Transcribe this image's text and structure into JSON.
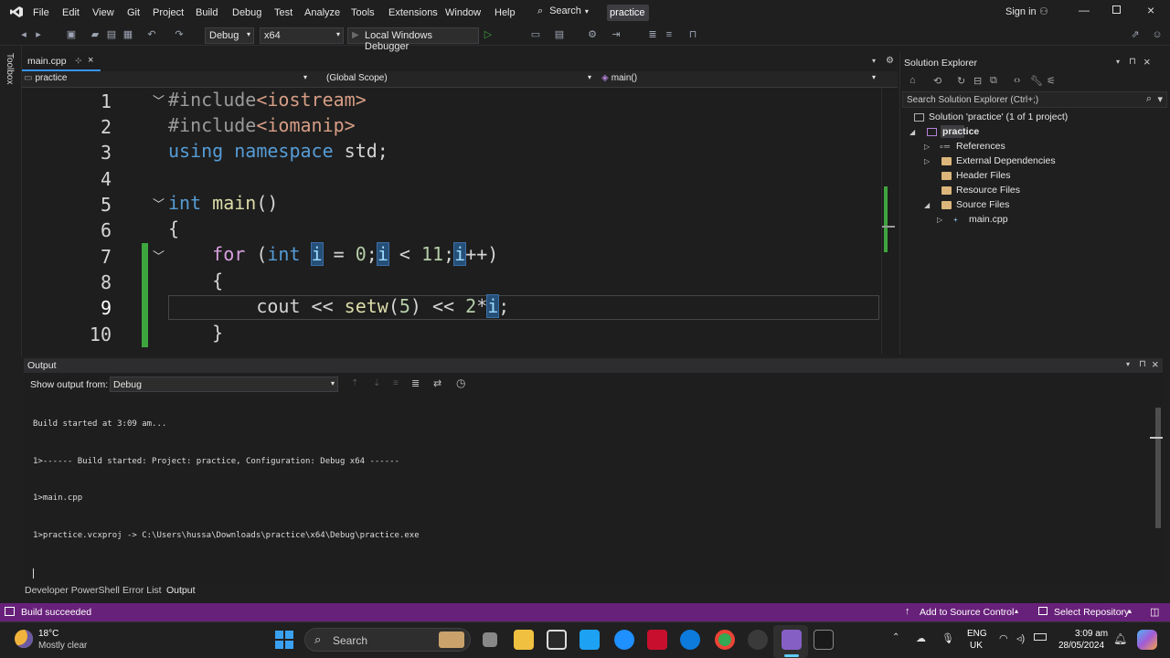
{
  "menubar": {
    "items": [
      "File",
      "Edit",
      "View",
      "Git",
      "Project",
      "Build",
      "Debug",
      "Test",
      "Analyze",
      "Tools",
      "Extensions",
      "Window",
      "Help"
    ],
    "search_label": "Search",
    "solution_badge": "practice",
    "signin": "Sign in"
  },
  "toolbar": {
    "config": "Debug",
    "platform": "x64",
    "debugger": "Local Windows Debugger"
  },
  "toolbox_label": "Toolbox",
  "editor": {
    "tab": "main.cpp",
    "project_scope": "practice",
    "global_scope": "(Global Scope)",
    "function_scope": "main()",
    "line_numbers": [
      "1",
      "2",
      "3",
      "4",
      "5",
      "6",
      "7",
      "8",
      "9",
      "10"
    ]
  },
  "solution_explorer": {
    "title": "Solution Explorer",
    "search_placeholder": "Search Solution Explorer (Ctrl+;)",
    "solution": "Solution 'practice' (1 of 1 project)",
    "project": "practice",
    "items": [
      "References",
      "External Dependencies",
      "Header Files",
      "Resource Files",
      "Source Files",
      "main.cpp"
    ]
  },
  "output": {
    "title": "Output",
    "show_from_label": "Show output from:",
    "source": "Debug",
    "lines": [
      "Build started at 3:09 am...",
      "1>------ Build started: Project: practice, Configuration: Debug x64 ------",
      "1>main.cpp",
      "1>practice.vcxproj -> C:\\Users\\hussa\\Downloads\\practice\\x64\\Debug\\practice.exe"
    ]
  },
  "bottom_tabs": [
    "Developer PowerShell",
    "Error List",
    "Output"
  ],
  "status": {
    "build": "Build succeeded",
    "source_control": "Add to Source Control",
    "repo": "Select Repository"
  },
  "taskbar": {
    "weather_temp": "18°C",
    "weather_desc": "Mostly clear",
    "search": "Search",
    "lang1": "ENG",
    "lang2": "UK",
    "time": "3:09 am",
    "date": "28/05/2024"
  },
  "colors": {
    "accent": "#68217a",
    "keyword": "#569cd6",
    "number": "#b5cea8",
    "function": "#dcdcaa",
    "control": "#d8a0df"
  }
}
